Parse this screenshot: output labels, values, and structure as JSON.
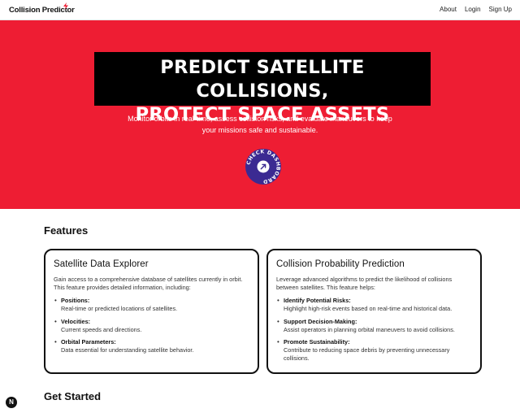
{
  "nav": {
    "logo": "Collision Predictor",
    "links": [
      "About",
      "Login",
      "Sign Up"
    ]
  },
  "hero": {
    "title_line1": "PREDICT SATELLITE COLLISIONS,",
    "title_line2": "PROTECT SPACE ASSETS",
    "subtitle": "Monitor orbits in real-time, assess collision risks, and evaluate maneuvers to keep your missions safe and sustainable.",
    "badge_text": "CHECK DASHBOARD",
    "badge_icon": "arrow-up-right-icon"
  },
  "features": {
    "heading": "Features",
    "cards": [
      {
        "title": "Satellite Data Explorer",
        "intro": "Gain access to a comprehensive database of satellites currently in orbit. This feature provides detailed information, including:",
        "items": [
          {
            "term": "Positions:",
            "desc": "Real-time or predicted locations of satellites."
          },
          {
            "term": "Velocities:",
            "desc": "Current speeds and directions."
          },
          {
            "term": "Orbital Parameters:",
            "desc": "Data essential for understanding satellite behavior."
          }
        ]
      },
      {
        "title": "Collision Probability Prediction",
        "intro": "Leverage advanced algorithms to predict the likelihood of collisions between satellites. This feature helps:",
        "items": [
          {
            "term": "Identify Potential Risks:",
            "desc": "Highlight high-risk events based on real-time and historical data."
          },
          {
            "term": "Support Decision-Making:",
            "desc": "Assist operators in planning orbital maneuvers to avoid collisions."
          },
          {
            "term": "Promote Sustainability:",
            "desc": "Contribute to reducing space debris by preventing unnecessary collisions."
          }
        ]
      }
    ]
  },
  "get_started": {
    "heading": "Get Started"
  },
  "dev_badge": "N",
  "colors": {
    "hero_bg": "#ee1d33",
    "badge_bg": "#3b2a92",
    "title_bg": "#000000"
  }
}
